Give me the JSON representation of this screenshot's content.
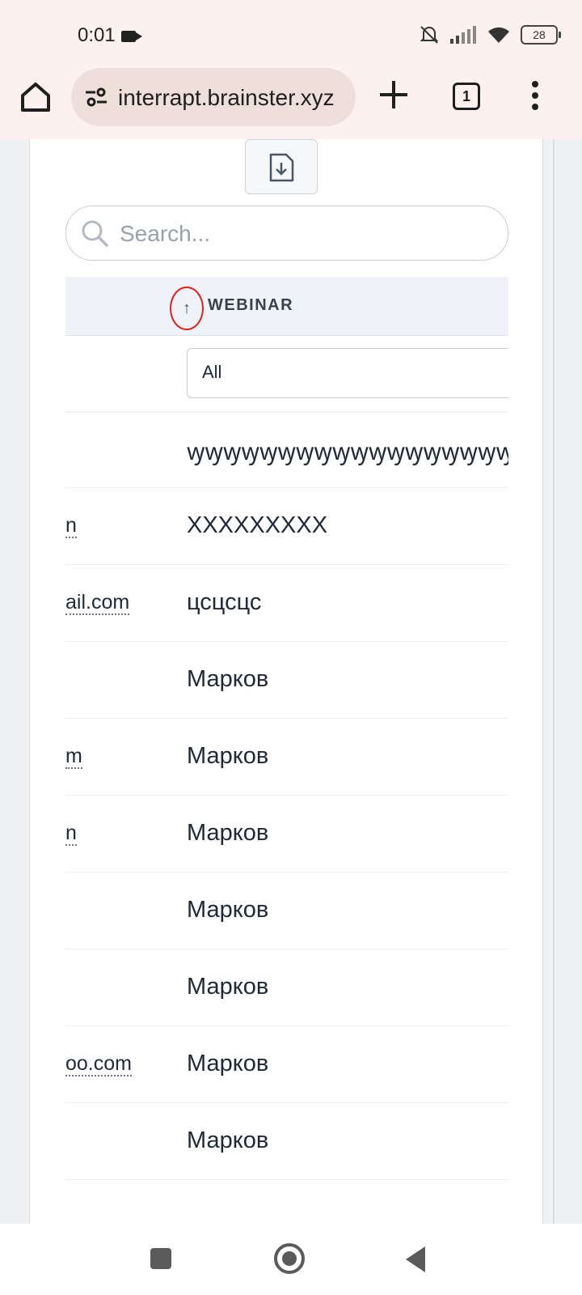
{
  "status_bar": {
    "time": "0:01",
    "battery": "28"
  },
  "browser": {
    "url": "interrapt.brainster.xyz",
    "tab_count": "1"
  },
  "search": {
    "placeholder": "Search..."
  },
  "table": {
    "column_header": "WEBINAR",
    "sort_indicator": "↑",
    "filter_value": "All",
    "rows": [
      {
        "email": "",
        "webinar": "ꝡꝡꝡꝡꝡꝡꝡꝡꝡꝡꝡꝡꝡꝡꝡꝡꝡꝡꝡꝡꝡꝡꝡꝡꝡꝡꝡꝡꝡꝡꝡꝡꝡꝡꝡꝡꝡꝡꝡꝡ"
      },
      {
        "email": "n",
        "webinar": "XXXXXXXXX"
      },
      {
        "email": "ail.com",
        "webinar": "цсцсцс"
      },
      {
        "email": "",
        "webinar": "Марков"
      },
      {
        "email": "m",
        "webinar": "Марков"
      },
      {
        "email": "n",
        "webinar": "Марков"
      },
      {
        "email": "",
        "webinar": "Марков"
      },
      {
        "email": "",
        "webinar": "Марков"
      },
      {
        "email": "oo.com",
        "webinar": "Марков"
      },
      {
        "email": "",
        "webinar": "Марков"
      }
    ]
  }
}
